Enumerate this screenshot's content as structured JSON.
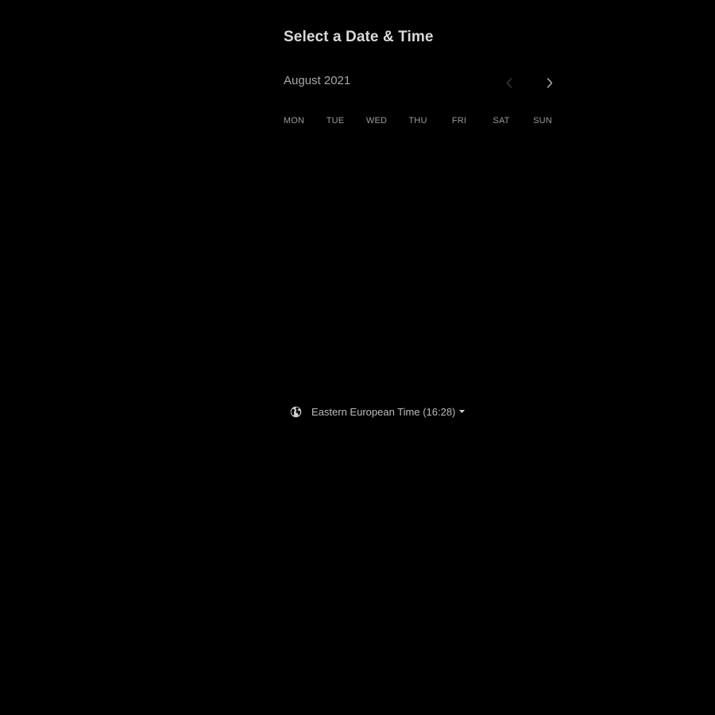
{
  "header": {
    "title": "Select a Date & Time"
  },
  "calendar": {
    "month_label": "August 2021",
    "prev_icon": "chevron-left-icon",
    "next_icon": "chevron-right-icon",
    "weekdays": [
      "MON",
      "TUE",
      "WED",
      "THU",
      "FRI",
      "SAT",
      "SUN"
    ]
  },
  "timezone": {
    "icon": "globe-icon",
    "label": "Eastern European Time (16:28)",
    "dropdown_icon": "caret-down-icon"
  },
  "colors": {
    "background": "#000000",
    "title": "#d9d9d9",
    "muted_text": "#a8a8a8"
  }
}
